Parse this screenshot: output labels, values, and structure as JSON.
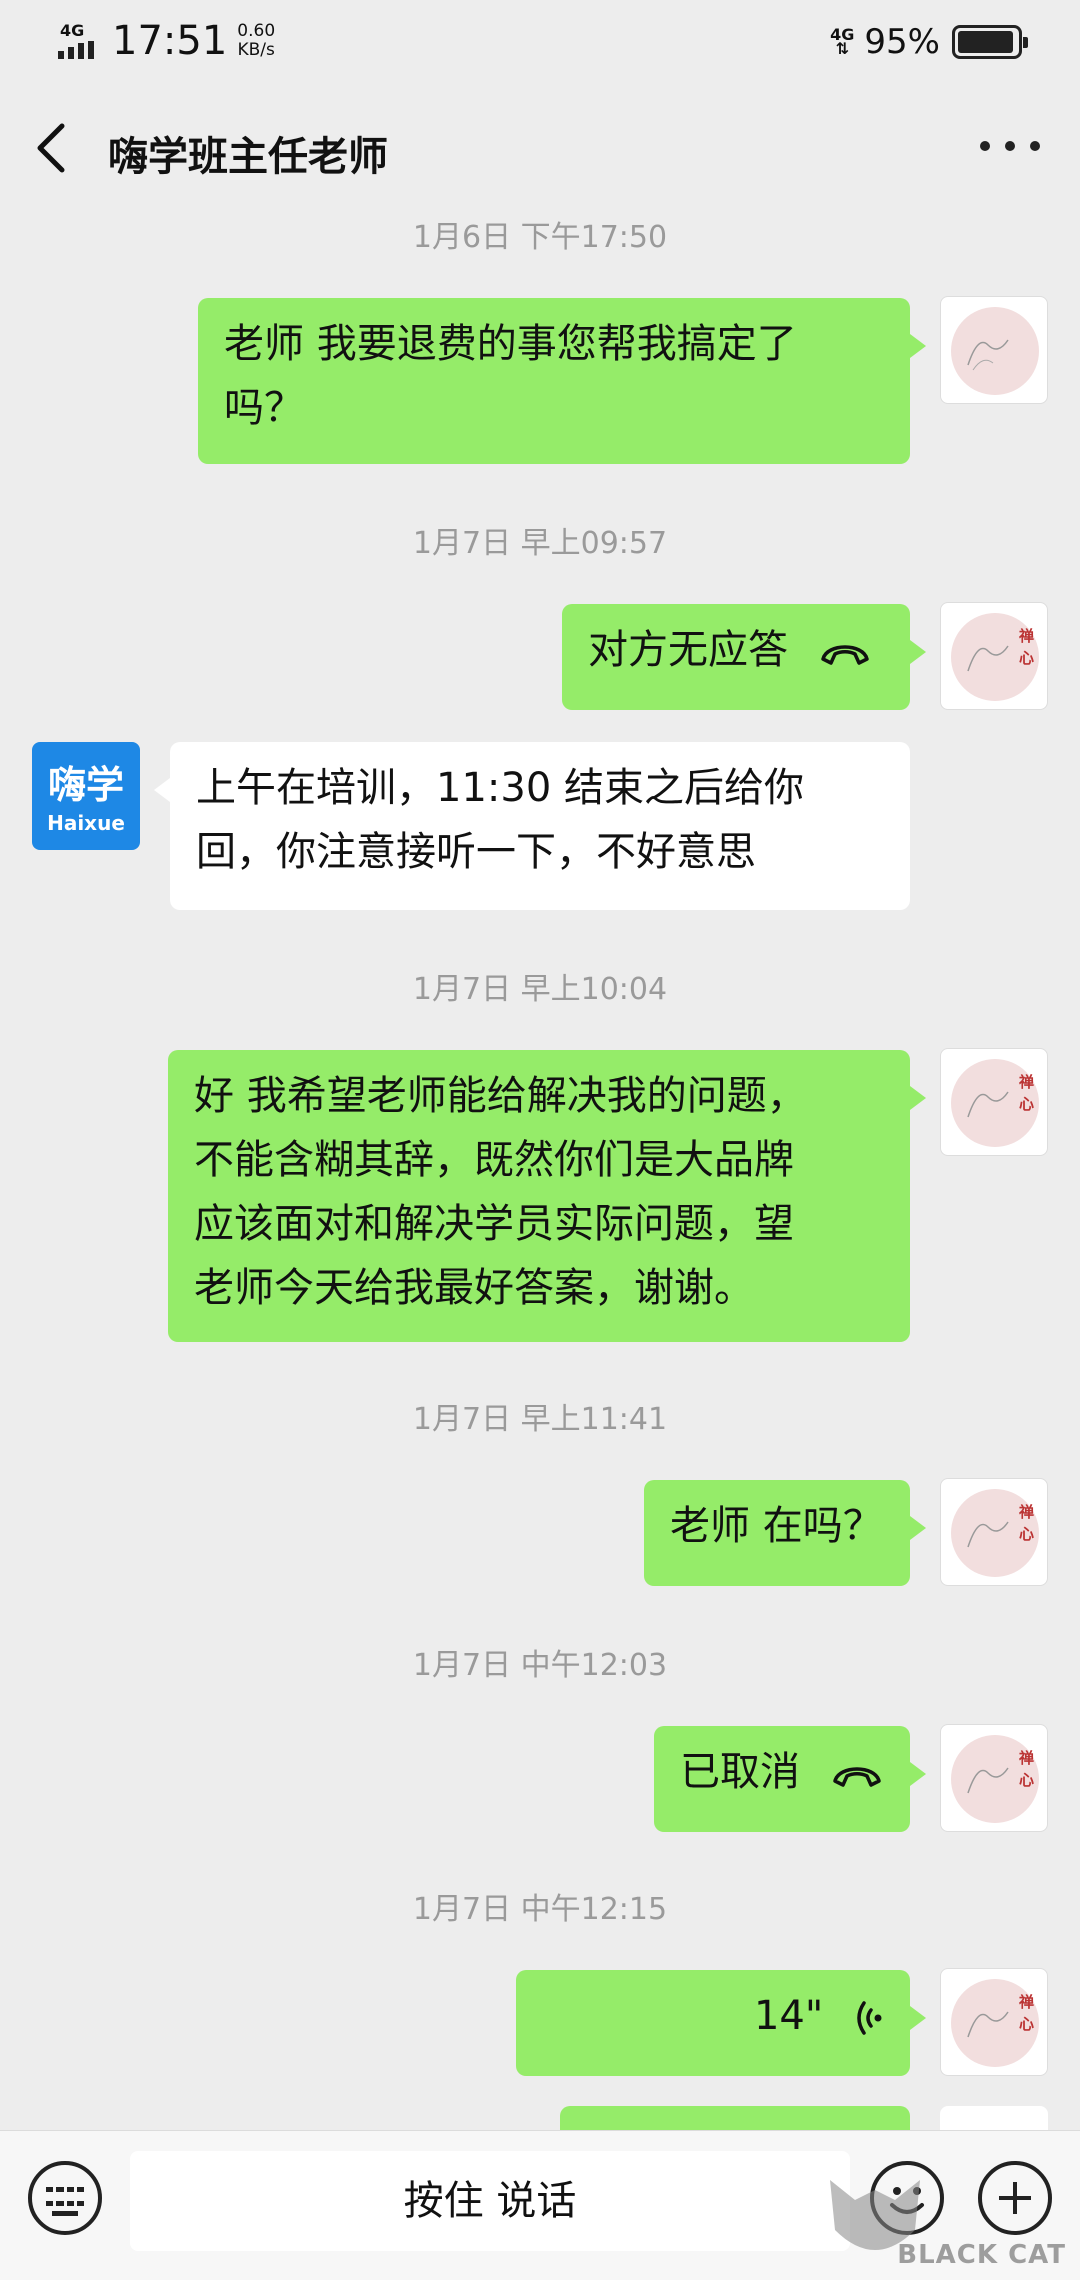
{
  "status_bar": {
    "network": "4G",
    "time": "17:51",
    "speed_value": "0.60",
    "speed_unit": "KB/s",
    "network_right": "4G",
    "battery": "95%"
  },
  "header": {
    "title": "嗨学班主任老师"
  },
  "messages": [
    {
      "type": "timestamp",
      "text": "1月6日 下午17:50"
    },
    {
      "type": "text",
      "from": "me",
      "lines": [
        "老师  我要退费的事您帮我搞定了",
        "吗？"
      ]
    },
    {
      "type": "timestamp",
      "text": "1月7日 早上09:57"
    },
    {
      "type": "call",
      "from": "me",
      "text": "对方无应答"
    },
    {
      "type": "text",
      "from": "them",
      "lines": [
        "上午在培训，11:30 结束之后给你",
        "回，你注意接听一下，不好意思"
      ]
    },
    {
      "type": "timestamp",
      "text": "1月7日 早上10:04"
    },
    {
      "type": "text",
      "from": "me",
      "lines": [
        "好  我希望老师能给解决我的问题，",
        "不能含糊其辞，既然你们是大品牌",
        "应该面对和解决学员实际问题，望",
        "老师今天给我最好答案，谢谢。"
      ]
    },
    {
      "type": "timestamp",
      "text": "1月7日 早上11:41"
    },
    {
      "type": "text",
      "from": "me",
      "text": "老师 在吗？"
    },
    {
      "type": "timestamp",
      "text": "1月7日 中午12:03"
    },
    {
      "type": "call",
      "from": "me",
      "text": "已取消"
    },
    {
      "type": "timestamp",
      "text": "1月7日 中午12:15"
    },
    {
      "type": "voice",
      "from": "me",
      "duration": "14\""
    }
  ],
  "avatars": {
    "me_chars": "禅心",
    "them_line1": "嗨学",
    "them_line2": "Haixue"
  },
  "input_bar": {
    "hold_to_talk": "按住 说话"
  },
  "watermark": {
    "text": "BLACK CAT"
  }
}
